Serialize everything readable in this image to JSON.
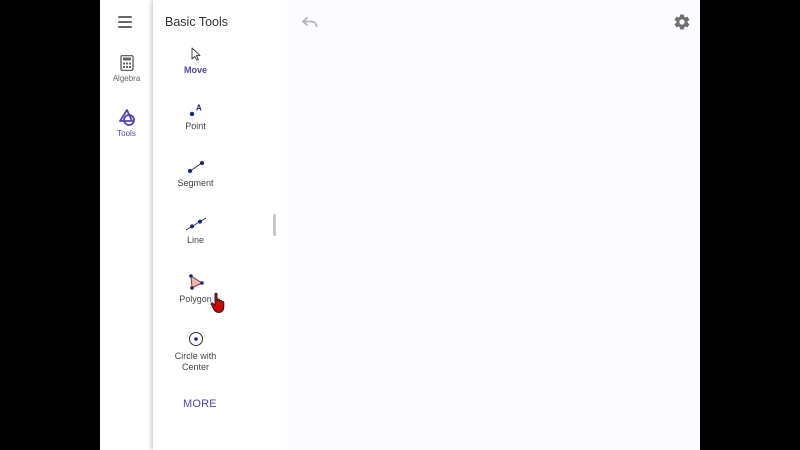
{
  "rail": {
    "items": [
      {
        "label": "Algebra",
        "icon": "calculator-icon"
      },
      {
        "label": "Tools",
        "icon": "tools-shapes-icon"
      }
    ],
    "active": "Tools"
  },
  "panel": {
    "title": "Basic Tools",
    "tools": [
      {
        "label": "Move",
        "icon": "arrow-cursor-icon"
      },
      {
        "label": "Point",
        "icon": "point-icon"
      },
      {
        "label": "Segment",
        "icon": "segment-icon"
      },
      {
        "label": "Line",
        "icon": "line-icon"
      },
      {
        "label": "Polygon",
        "icon": "polygon-icon"
      },
      {
        "label_line1": "Circle with",
        "label_line2": "Center",
        "icon": "circle-center-icon"
      }
    ],
    "selected": "Move",
    "more": "MORE"
  },
  "colors": {
    "accent": "#5145a8",
    "tool_blue": "#1a237e",
    "polygon_fill": "#e8b7b0",
    "graphics_bg": "#fcfbff"
  }
}
